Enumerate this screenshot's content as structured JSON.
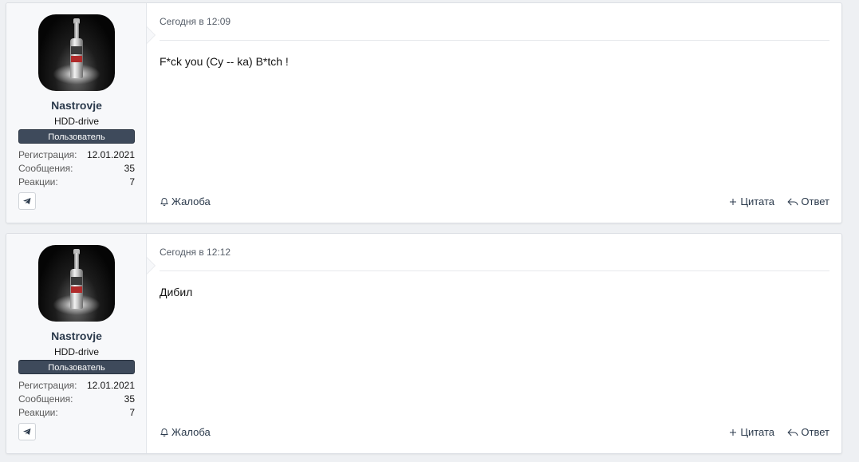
{
  "posts": [
    {
      "author": {
        "username": "Nastrovje",
        "user_title": "HDD-drive",
        "banner": "Пользователь",
        "stats": [
          {
            "key": "Регистрация:",
            "value": "12.01.2021"
          },
          {
            "key": "Сообщения:",
            "value": "35"
          },
          {
            "key": "Реакции:",
            "value": "7"
          }
        ],
        "contact_icon": "telegram-icon"
      },
      "date": "Сегодня в 12:09",
      "message": "F*ck you (Cy -- ka) B*tch !",
      "actions": {
        "report": "Жалоба",
        "quote": "Цитата",
        "reply": "Ответ"
      }
    },
    {
      "author": {
        "username": "Nastrovje",
        "user_title": "HDD-drive",
        "banner": "Пользователь",
        "stats": [
          {
            "key": "Регистрация:",
            "value": "12.01.2021"
          },
          {
            "key": "Сообщения:",
            "value": "35"
          },
          {
            "key": "Реакции:",
            "value": "7"
          }
        ],
        "contact_icon": "telegram-icon"
      },
      "date": "Сегодня в 12:12",
      "message": "Дибил",
      "actions": {
        "report": "Жалоба",
        "quote": "Цитата",
        "reply": "Ответ"
      }
    }
  ],
  "colors": {
    "page_bg": "#eef0f3",
    "user_cell_bg": "#f7f8fa",
    "banner_bg": "#3e4a5b",
    "username": "#2b3a4c",
    "link": "#2b3a4c"
  }
}
